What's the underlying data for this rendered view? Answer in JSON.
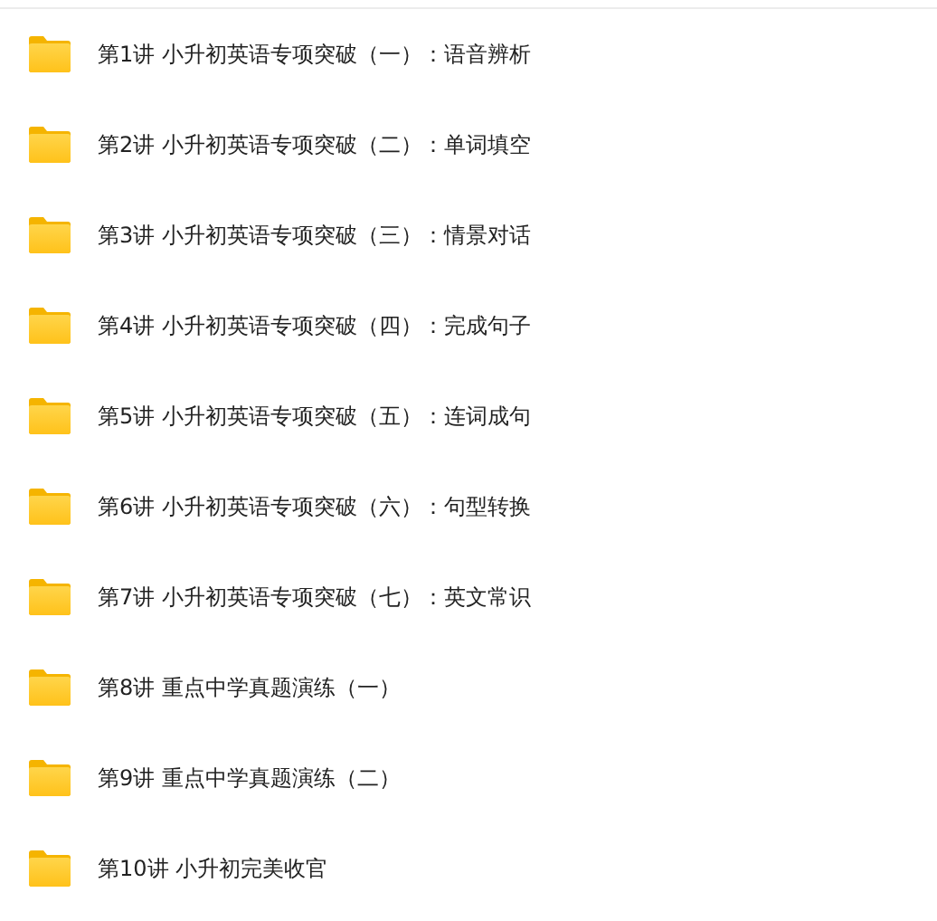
{
  "folders": [
    {
      "name": "第1讲 小升初英语专项突破（一）：语音辨析"
    },
    {
      "name": "第2讲 小升初英语专项突破（二）：单词填空"
    },
    {
      "name": "第3讲 小升初英语专项突破（三）：情景对话"
    },
    {
      "name": "第4讲 小升初英语专项突破（四）：完成句子"
    },
    {
      "name": "第5讲 小升初英语专项突破（五）：连词成句"
    },
    {
      "name": "第6讲 小升初英语专项突破（六）：句型转换"
    },
    {
      "name": "第7讲 小升初英语专项突破（七）：英文常识"
    },
    {
      "name": "第8讲 重点中学真题演练（一）"
    },
    {
      "name": "第9讲 重点中学真题演练（二）"
    },
    {
      "name": "第10讲 小升初完美收官"
    }
  ]
}
